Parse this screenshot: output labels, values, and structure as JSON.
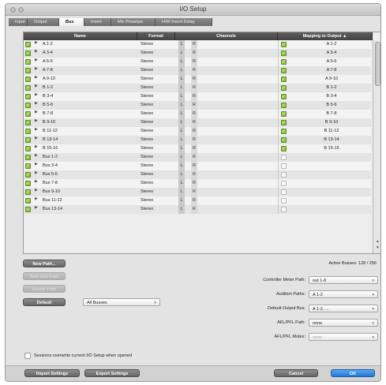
{
  "window": {
    "title": "I/O Setup"
  },
  "tabs": [
    {
      "label": "Input"
    },
    {
      "label": "Output"
    },
    {
      "label": "Bus",
      "active": true
    },
    {
      "label": "Insert"
    },
    {
      "label": "Mic Preamps"
    },
    {
      "label": "H/W Insert Delay"
    }
  ],
  "table": {
    "headers": {
      "name": "Name",
      "format": "Format",
      "channels": "Channels",
      "mapping": "Mapping to Output"
    },
    "sort_indicator": "▲",
    "channel_labels": [
      "L",
      "R"
    ],
    "rows": [
      {
        "name": "A 1-2",
        "format": "Stereo",
        "mapped": true,
        "output": "A 1-2"
      },
      {
        "name": "A 3-4",
        "format": "Stereo",
        "mapped": true,
        "output": "A 3-4"
      },
      {
        "name": "A 5-6",
        "format": "Stereo",
        "mapped": true,
        "output": "A 5-6"
      },
      {
        "name": "A 7-8",
        "format": "Stereo",
        "mapped": true,
        "output": "A 7-8"
      },
      {
        "name": "A 9-10",
        "format": "Stereo",
        "mapped": true,
        "output": "A 9-10"
      },
      {
        "name": "B 1-2",
        "format": "Stereo",
        "mapped": true,
        "output": "B 1-2"
      },
      {
        "name": "B 3-4",
        "format": "Stereo",
        "mapped": true,
        "output": "B 3-4"
      },
      {
        "name": "B 5-6",
        "format": "Stereo",
        "mapped": true,
        "output": "B 5-6"
      },
      {
        "name": "B 7-8",
        "format": "Stereo",
        "mapped": true,
        "output": "B 7-8"
      },
      {
        "name": "B 9-10",
        "format": "Stereo",
        "mapped": true,
        "output": "B 9-10"
      },
      {
        "name": "B 11-12",
        "format": "Stereo",
        "mapped": true,
        "output": "B 11-12"
      },
      {
        "name": "B 13-14",
        "format": "Stereo",
        "mapped": true,
        "output": "B 13-14"
      },
      {
        "name": "B 15-16",
        "format": "Stereo",
        "mapped": true,
        "output": "B 15-16"
      },
      {
        "name": "Bus 1-2",
        "format": "Stereo",
        "mapped": false,
        "output": ""
      },
      {
        "name": "Bus 3-4",
        "format": "Stereo",
        "mapped": false,
        "output": ""
      },
      {
        "name": "Bus 5-6",
        "format": "Stereo",
        "mapped": false,
        "output": ""
      },
      {
        "name": "Bus 7-8",
        "format": "Stereo",
        "mapped": false,
        "output": ""
      },
      {
        "name": "Bus 9-10",
        "format": "Stereo",
        "mapped": false,
        "output": ""
      },
      {
        "name": "Bus 11-12",
        "format": "Stereo",
        "mapped": false,
        "output": ""
      },
      {
        "name": "Bus 13-14",
        "format": "Stereo",
        "mapped": false,
        "output": ""
      }
    ]
  },
  "buttons": {
    "new_path": "New Path...",
    "new_sub_path": "New Sub-Path",
    "delete_path": "Delete Path",
    "default": "Default",
    "import": "Import Settings",
    "export": "Export Settings",
    "cancel": "Cancel",
    "ok": "OK"
  },
  "default_scope": "All Busses",
  "active_busses": "Active Busses: 128 / 256",
  "settings": [
    {
      "label": "Controller Meter Path:",
      "value": "out 1-8",
      "enabled": true
    },
    {
      "label": "Audition Paths:",
      "value": "A 1-2",
      "enabled": true
    },
    {
      "label": "Default Output Bus:",
      "value": "A 1-2, ...",
      "enabled": true
    },
    {
      "label": "AFL/PFL Path:",
      "value": "none",
      "enabled": true
    },
    {
      "label": "AFL/PFL Mutes:",
      "value": "none",
      "enabled": false
    }
  ],
  "sessions_overwrite": {
    "label": "Sessions overwrite current I/O Setup when opened",
    "checked": false
  },
  "colors": {
    "check_on": "#8fc13e",
    "header_bg": "#4a4a4a",
    "ok_button": "#2f82df"
  }
}
